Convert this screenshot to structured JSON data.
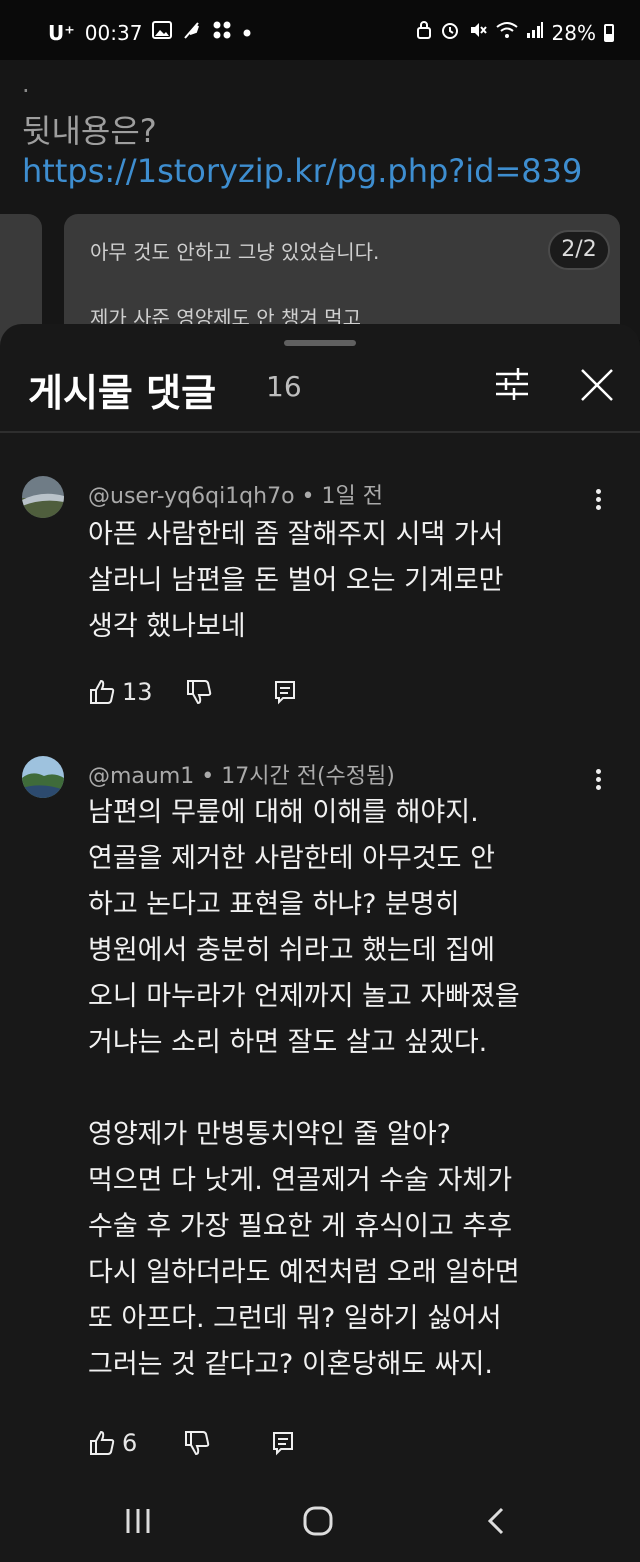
{
  "status_bar": {
    "carrier": "U⁺",
    "time": "00:37",
    "battery": "28%",
    "icons_left": [
      "gallery-icon",
      "feather-icon",
      "apps-icon",
      "dot-icon"
    ],
    "icons_right": [
      "lock-icon",
      "alarm-icon",
      "mute-icon",
      "wifi-icon",
      "signal-icon",
      "battery-icon"
    ]
  },
  "background_post": {
    "dot": ".",
    "question": "뒷내용은?",
    "link": "https://1storyzip.kr/pg.php?id=839",
    "card_line1": "아무 것도 안하고 그냥 있었습니다.",
    "card_line2": "제가 사준 영양제도 안 챙겨 먹고",
    "pager": "2/2"
  },
  "sheet": {
    "title": "게시물 댓글",
    "count": "16"
  },
  "comments": [
    {
      "author": "@user-yq6qi1qh7o",
      "time": "1일 전",
      "text": "아픈 사람한테 좀 잘해주지 시댁 가서\n살라니 남편을 돈 벌어 오는 기계로만\n생각 했나보네",
      "likes": "13"
    },
    {
      "author": "@maum1",
      "time": "17시간 전(수정됨)",
      "text": "남편의 무릎에 대해 이해를 해야지.\n연골을 제거한 사람한테 아무것도 안\n하고 논다고 표현을 하냐? 분명히\n병원에서 충분히 쉬라고 했는데 집에\n오니 마누라가 언제까지 놀고 자빠졌을\n거냐는 소리 하면 잘도 살고 싶겠다.\n\n영양제가 만병통치약인 줄 알아?\n먹으면 다 낫게. 연골제거 수술 자체가\n수술 후 가장 필요한 게 휴식이고 추후\n다시 일하더라도 예전처럼 오래 일하면\n또 아프다. 그런데 뭐? 일하기 싫어서\n그러는 것 같다고? 이혼당해도 싸지.",
      "likes": "6"
    }
  ],
  "separator": " • ",
  "nav": [
    "recent-apps-icon",
    "home-icon",
    "back-icon"
  ]
}
